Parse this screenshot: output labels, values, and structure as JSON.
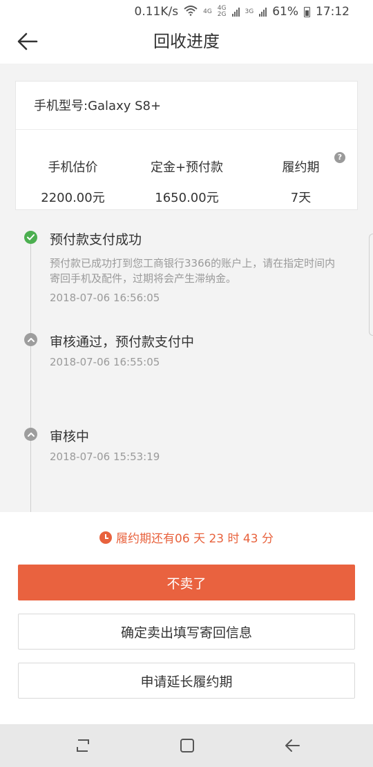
{
  "status_bar": {
    "speed": "0.11K/s",
    "net_a": "4G",
    "net_b_top": "4G",
    "net_b_bottom": "2G",
    "net_c": "3G",
    "battery": "61%",
    "time": "17:12",
    "icons": [
      "wifi-icon",
      "signal-icon",
      "battery-icon"
    ]
  },
  "header": {
    "title": "回收进度",
    "back_icon": "arrow-left-icon"
  },
  "device": {
    "model": "手机型号:Galaxy S8+"
  },
  "stats": [
    {
      "label": "手机估价",
      "value": "2200.00元"
    },
    {
      "label": "定金+预付款",
      "value": "1650.00元"
    },
    {
      "label": "履约期",
      "value": "7天"
    }
  ],
  "help_icon": {
    "glyph": "?"
  },
  "timeline": [
    {
      "status": "done",
      "icon": "check-icon",
      "title": "预付款支付成功",
      "desc": "预付款已成功打到您工商银行3366的账户上，请在指定时间内寄回手机及配件，过期将会产生滞纳金。",
      "time": "2018-07-06 16:56:05"
    },
    {
      "status": "past",
      "icon": "chevron-up-icon",
      "title": "审核通过，预付款支付中",
      "time": "2018-07-06 16:55:05"
    },
    {
      "status": "past",
      "icon": "chevron-up-icon",
      "title": "审核中",
      "time": "2018-07-06 15:53:19"
    }
  ],
  "countdown": {
    "text": "履约期还有06 天 23 时 43 分",
    "icon": "clock-icon"
  },
  "buttons": {
    "cancel_sale": "不卖了",
    "confirm_sale": "确定卖出填写寄回信息",
    "extend": "申请延长履约期"
  },
  "nav": {
    "icons": [
      "recent-apps-icon",
      "home-icon",
      "back-icon"
    ]
  },
  "colors": {
    "accent": "#e9623f",
    "success": "#4caf50",
    "muted": "#9a9a9a",
    "background": "#f3f3f3"
  }
}
